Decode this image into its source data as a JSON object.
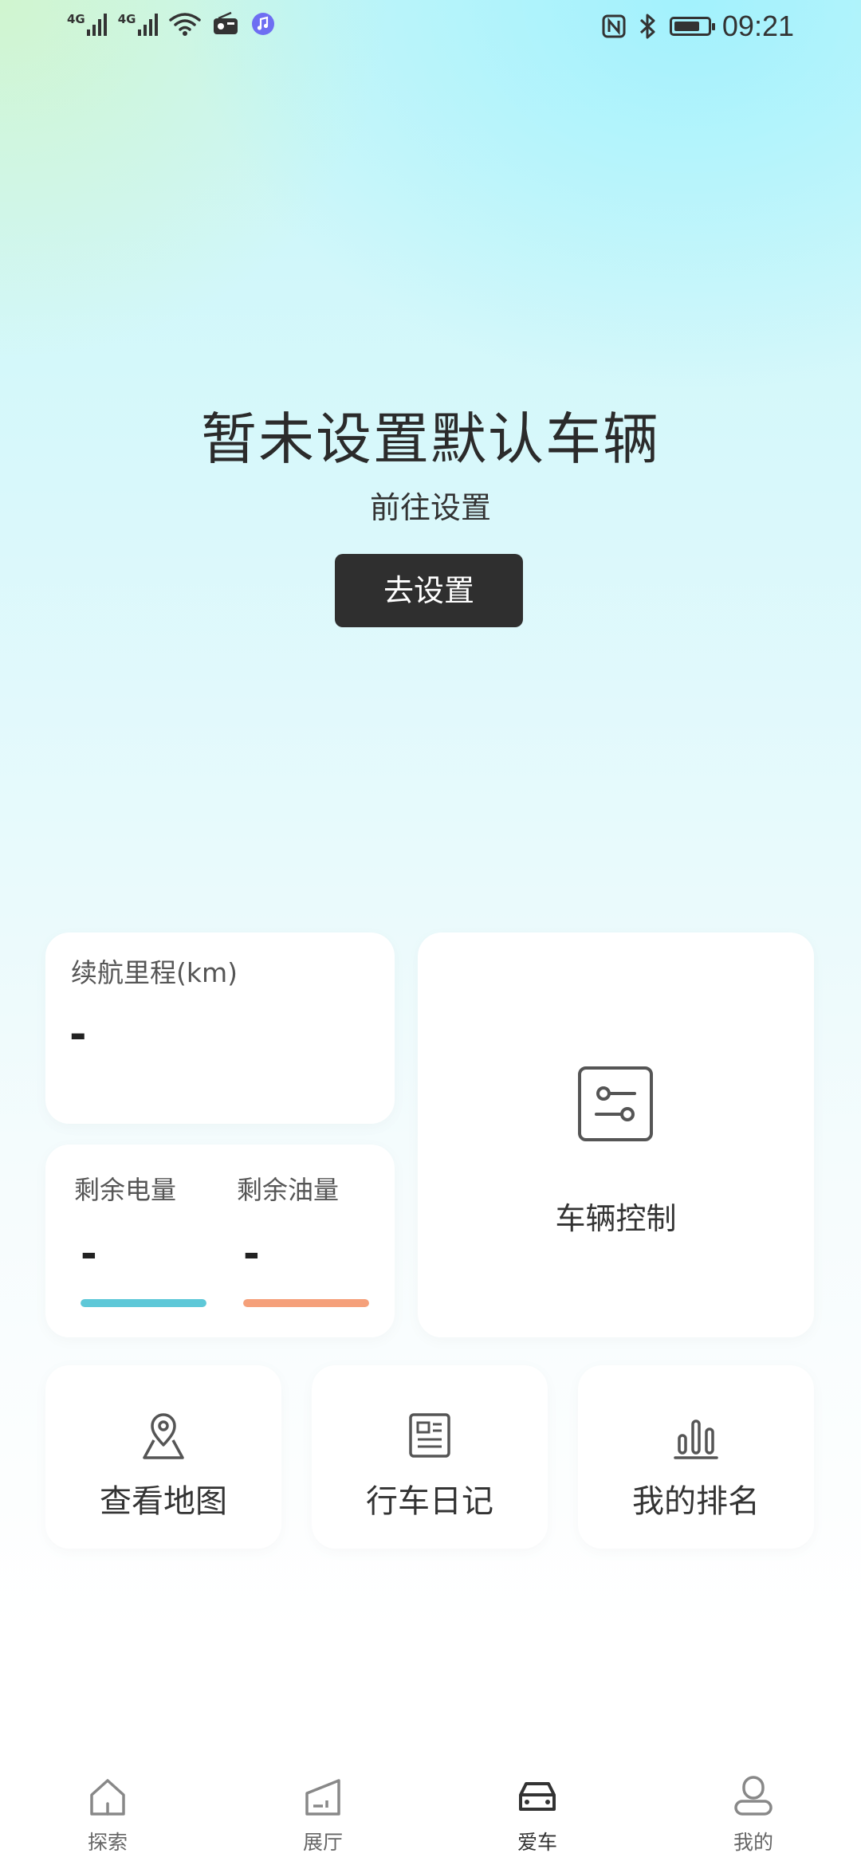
{
  "status_bar": {
    "left_signals": [
      {
        "label": "4G"
      },
      {
        "label": "4G"
      }
    ],
    "time": "09:21",
    "battery_level": 0.8
  },
  "hero": {
    "title": "暂未设置默认车辆",
    "subtitle": "前往设置",
    "button_label": "去设置"
  },
  "range_card": {
    "label": "续航里程(km)",
    "value": "-"
  },
  "energy_card": {
    "battery_label": "剩余电量",
    "battery_value": "-",
    "fuel_label": "剩余油量",
    "fuel_value": "-",
    "battery_color": "#5ec8d8",
    "fuel_color": "#f5a07a",
    "battery_level": 1.0,
    "fuel_level": 1.0
  },
  "control_card": {
    "label": "车辆控制",
    "icon": "vehicle-control-icon"
  },
  "quick_actions": [
    {
      "label": "查看地图",
      "icon": "map-pin-icon"
    },
    {
      "label": "行车日记",
      "icon": "journal-icon"
    },
    {
      "label": "我的排名",
      "icon": "ranking-chart-icon"
    }
  ],
  "tab_bar": {
    "tabs": [
      {
        "label": "探索",
        "icon": "home-icon",
        "active": false
      },
      {
        "label": "展厅",
        "icon": "showroom-icon",
        "active": false
      },
      {
        "label": "爱车",
        "icon": "car-icon",
        "active": true
      },
      {
        "label": "我的",
        "icon": "profile-icon",
        "active": false
      }
    ]
  },
  "colors": {
    "button_bg": "#2f2f2f",
    "text_primary": "#222222",
    "tab_active": "#333333",
    "tab_inactive": "#666666"
  }
}
